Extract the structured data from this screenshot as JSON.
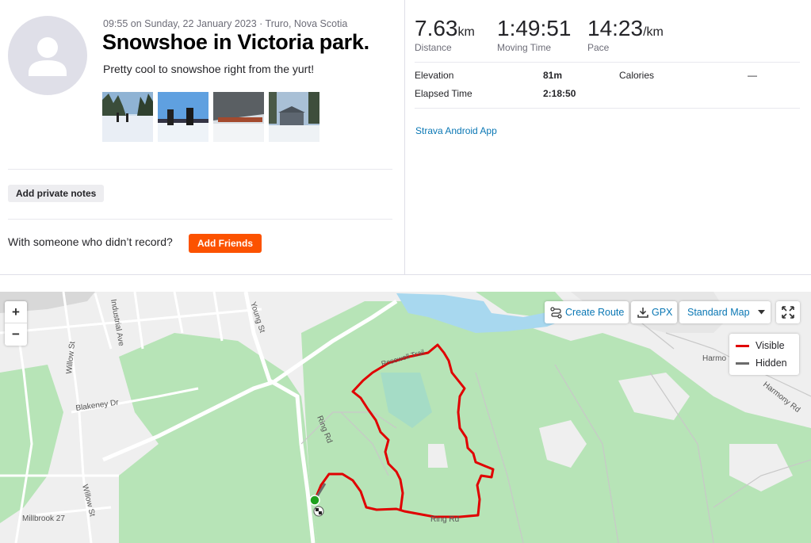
{
  "activity": {
    "meta": "09:55 on Sunday, 22 January 2023 · Truro, Nova Scotia",
    "title": "Snowshoe in Victoria park.",
    "description": "Pretty cool to snowshoe right from the yurt!",
    "private_notes_label": "Add private notes",
    "with_someone_text": "With someone who didn’t record?",
    "add_friends_label": "Add Friends"
  },
  "stats": {
    "distance": {
      "value": "7.63",
      "unit": "km",
      "label": "Distance"
    },
    "moving_time": {
      "value": "1:49:51",
      "label": "Moving Time"
    },
    "pace": {
      "value": "14:23",
      "unit": "/km",
      "label": "Pace"
    },
    "elevation_label": "Elevation",
    "elevation_value": "81m",
    "calories_label": "Calories",
    "calories_value": "—",
    "elapsed_label": "Elapsed Time",
    "elapsed_value": "2:18:50",
    "device": "Strava Android App"
  },
  "map": {
    "zoom_in": "+",
    "zoom_out": "−",
    "create_route": "Create Route",
    "gpx": "GPX",
    "map_type": "Standard Map",
    "legend": {
      "visible": "Visible",
      "hidden": "Hidden"
    },
    "labels": {
      "willow_st": "Willow St",
      "industrial_ave": "Industrial Ave",
      "young_st": "Young St",
      "blakeney_dr": "Blakeney Dr",
      "ring_rd": "Ring Rd",
      "ring_rd_2": "Ring Rd",
      "millbrook": "Millbrook 27",
      "harmony": "Harmo",
      "harmony_rd": "Harmony Rd",
      "trail": "Rosewell Trail"
    }
  },
  "colors": {
    "brand": "#fc5200",
    "link": "#0a77b4",
    "route": "#e00000",
    "start": "#1ea11e",
    "park": "#b7e4b7"
  }
}
